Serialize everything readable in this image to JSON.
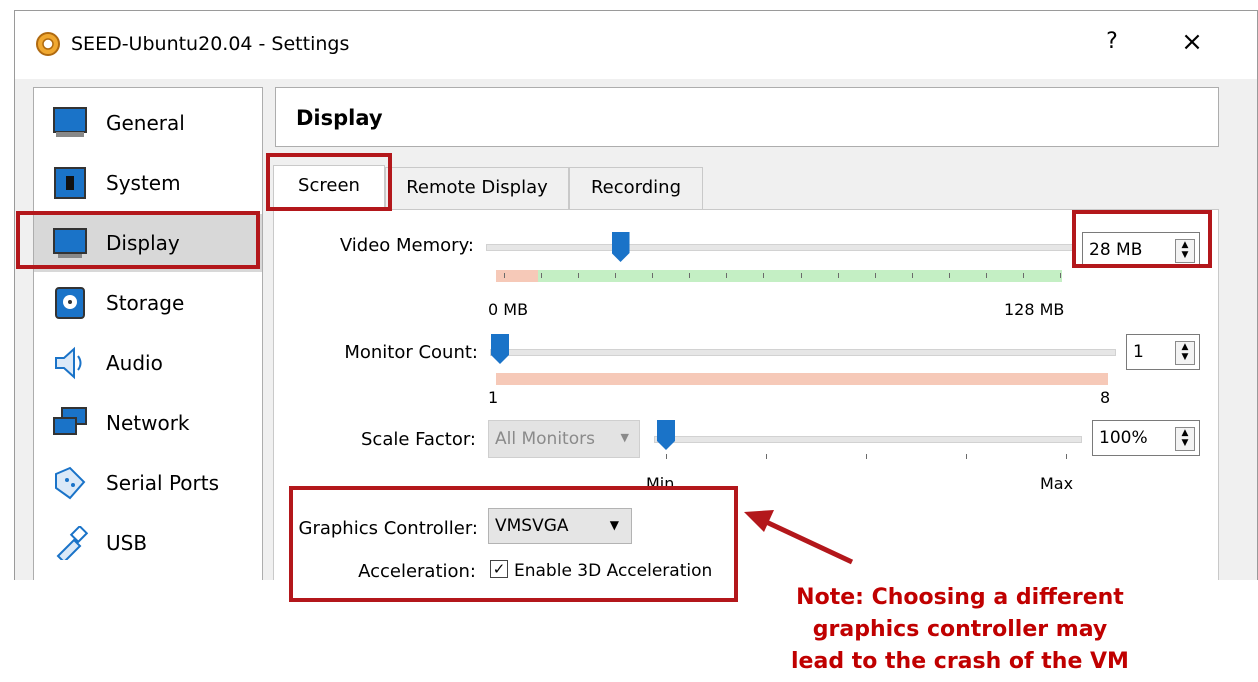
{
  "window": {
    "title": "SEED-Ubuntu20.04 - Settings",
    "help": "?",
    "close": "×"
  },
  "sidebar": {
    "items": [
      {
        "label": "General",
        "icon": "general-icon"
      },
      {
        "label": "System",
        "icon": "system-icon"
      },
      {
        "label": "Display",
        "icon": "display-icon",
        "selected": true
      },
      {
        "label": "Storage",
        "icon": "storage-icon"
      },
      {
        "label": "Audio",
        "icon": "audio-icon"
      },
      {
        "label": "Network",
        "icon": "network-icon"
      },
      {
        "label": "Serial Ports",
        "icon": "serial-ports-icon"
      },
      {
        "label": "USB",
        "icon": "usb-icon"
      }
    ]
  },
  "section": {
    "title": "Display"
  },
  "tabs": [
    "Screen",
    "Remote Display",
    "Recording"
  ],
  "screen": {
    "video_memory": {
      "label": "Video Memory:",
      "value": "28 MB",
      "min": "0 MB",
      "max": "128 MB",
      "level": 0.22
    },
    "monitor_count": {
      "label": "Monitor Count:",
      "value": "1",
      "min": "1",
      "max": "8",
      "level": 0
    },
    "scale_factor": {
      "label": "Scale Factor:",
      "scope": "All Monitors",
      "value": "100%",
      "min": "Min",
      "max": "Max",
      "level": 0
    },
    "graphics_controller": {
      "label": "Graphics Controller:",
      "value": "VMSVGA"
    },
    "acceleration": {
      "label": "Acceleration:",
      "option": "Enable 3D Acceleration",
      "checked": true
    }
  },
  "annotation": {
    "line1": "Note: Choosing a different",
    "line2": "graphics controller may",
    "line3": "lead to the crash of the VM"
  },
  "colors": {
    "highlight": "#b3171b",
    "slider": "#1a73c8",
    "note": "#c00000"
  }
}
